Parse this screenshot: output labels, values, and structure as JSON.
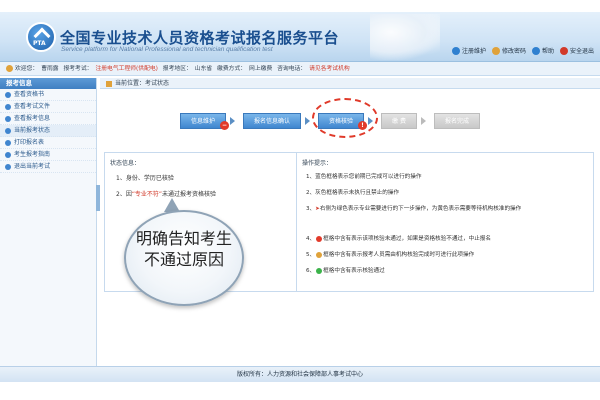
{
  "header": {
    "title_cn": "全国专业技术人员资格考试报名服务平台",
    "title_en": "Service platform for National Professional and technician qualification test",
    "logo_text": "PTA",
    "links": [
      {
        "label": "注册维护",
        "icon": "home-icon",
        "color": "#2f80d0"
      },
      {
        "label": "修改密码",
        "icon": "lock-icon",
        "color": "#e0a23a"
      },
      {
        "label": "帮助",
        "icon": "help-icon",
        "color": "#2f80d0"
      },
      {
        "label": "安全退出",
        "icon": "exit-icon",
        "color": "#d23a2a"
      }
    ]
  },
  "infobar": {
    "welcome": "欢迎您：",
    "user": "曹雨露",
    "exam_label": "报考考试：",
    "exam": "注册电气工程师(供配电)",
    "area_label": "报考地区：",
    "area": "山东省",
    "method_label": "缴费方式：",
    "method": "网上缴费",
    "phone_label": "咨询电话：",
    "link": "请见各考试机构"
  },
  "sidebar": {
    "title": "报考信息",
    "items": [
      {
        "label": "查看资格书"
      },
      {
        "label": "查看考试文件"
      },
      {
        "label": "查看报考信息"
      },
      {
        "label": "当前报考状态"
      },
      {
        "label": "打印报名表"
      },
      {
        "label": "考生报考指南"
      },
      {
        "label": "退出当前考试"
      }
    ]
  },
  "breadcrumb": {
    "label": "当前位置：",
    "page": "考试状态"
  },
  "steps": [
    {
      "label": "信息维护",
      "style": "blue",
      "badge": "−",
      "badge_color": "red"
    },
    {
      "label": "报名信息确认",
      "style": "blue",
      "badge": "",
      "badge_color": ""
    },
    {
      "label": "资格核验",
      "style": "blue",
      "badge": "!",
      "badge_color": "red"
    },
    {
      "label": "缴 费",
      "style": "gray",
      "badge": "",
      "badge_color": ""
    },
    {
      "label": "报名完成",
      "style": "gray",
      "badge": "",
      "badge_color": ""
    }
  ],
  "status": {
    "title": "状态信息：",
    "line1": "1、身份、学历已核验",
    "line2_prefix": "2、因",
    "line2_highlight": "“专业不符”",
    "line2_suffix": "未通过报考资格核验"
  },
  "tips": {
    "title": "操作提示：",
    "items": [
      {
        "num": "1、",
        "text": "蓝色框格表示您前期已完成可以进行的操作"
      },
      {
        "num": "2、",
        "text": "灰色框格表示未执行且禁止的操作"
      },
      {
        "num": "3、",
        "text": "右侧为绿色表示专业需要进行的下一步操作，为黄色表示需要等待机构核准的操作",
        "mark": "➤"
      },
      {
        "num": "4、",
        "text": "框格中含有表示该项核验未通过，如果是资格核验不通过，中止报名",
        "dot": "#e23a2a"
      },
      {
        "num": "5、",
        "text": "框格中含有表示报考人员需由机构核验完成时可进行此项操作",
        "dot": "#e0a23a"
      },
      {
        "num": "6、",
        "text": "框格中含有表示核验通过",
        "dot": "#3bb34a"
      }
    ]
  },
  "callout": {
    "text": "明确告知考生不通过原因"
  },
  "footer": {
    "text": "版权所有：人力资源和社会保障部人事考试中心"
  }
}
